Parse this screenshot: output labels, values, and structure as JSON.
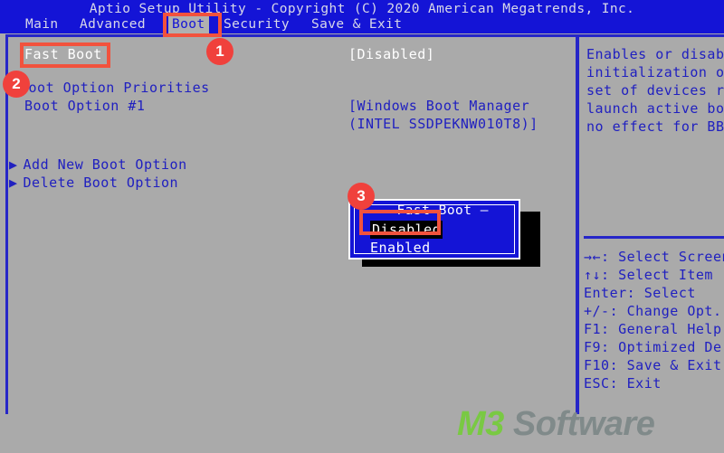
{
  "header": {
    "title": "Aptio Setup Utility - Copyright (C) 2020 American Megatrends, Inc.",
    "menu": [
      {
        "label": "Main",
        "selected": false
      },
      {
        "label": "Advanced",
        "selected": false
      },
      {
        "label": "Boot",
        "selected": true
      },
      {
        "label": "Security",
        "selected": false
      },
      {
        "label": "Save & Exit",
        "selected": false
      }
    ]
  },
  "settings": {
    "fast_boot_label": "Fast Boot",
    "fast_boot_value": "[Disabled]",
    "boot_option_priorities": "Boot Option Priorities",
    "boot_option_1_label": "Boot Option #1",
    "boot_option_1_value_line1": "[Windows Boot Manager",
    "boot_option_1_value_line2": "(INTEL SSDPEKNW010T8)]",
    "add_new_boot_option": "Add New Boot Option",
    "delete_boot_option": "Delete Boot Option",
    "arrow_glyph": "▶"
  },
  "help": {
    "lines": [
      "Enables or disab",
      "initialization o",
      "set of devices r",
      "launch active bo",
      "no effect for BB"
    ]
  },
  "legend": {
    "lines": [
      "→←: Select Screen",
      "↑↓: Select Item",
      "Enter: Select",
      "+/-: Change Opt.",
      "F1: General Help",
      "F9: Optimized De",
      "F10: Save & Exit",
      "ESC: Exit"
    ]
  },
  "popup": {
    "title": "Fast Boot",
    "title_decoration": "—",
    "options": [
      {
        "label": "Disabled",
        "selected": true
      },
      {
        "label": "Enabled",
        "selected": false
      }
    ]
  },
  "annotations": {
    "badges": [
      {
        "number": "1"
      },
      {
        "number": "2"
      },
      {
        "number": "3"
      }
    ]
  },
  "watermark": {
    "brand": "M3",
    "suffix": " Software",
    "brand_color": "#79c943",
    "suffix_color": "#808a8a"
  },
  "colors": {
    "screen_background": "#aaaaaa",
    "bios_blue": "#1414d6",
    "text_blue": "#2020c0",
    "annotation_red": "#f2523d",
    "badge_red": "#f0413c"
  }
}
